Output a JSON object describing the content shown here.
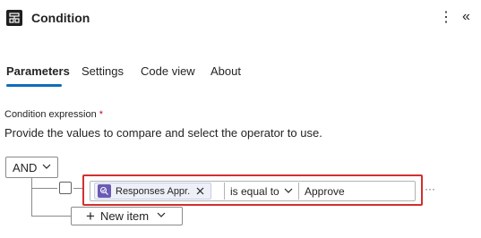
{
  "header": {
    "title": "Condition",
    "app_icon": "condition-icon",
    "more_icon": "⋮",
    "collapse_icon": "«"
  },
  "tabs": [
    {
      "label": "Parameters",
      "active": true
    },
    {
      "label": "Settings",
      "active": false
    },
    {
      "label": "Code view",
      "active": false
    },
    {
      "label": "About",
      "active": false
    }
  ],
  "condition": {
    "label": "Condition expression",
    "required_mark": "*",
    "description": "Provide the values to compare and select the operator to use.",
    "group_operator": "AND",
    "rows": [
      {
        "token_label": "Responses Appr...",
        "token_icon": "approvals-icon",
        "operator": "is equal to",
        "value": "Approve",
        "more": "···"
      }
    ],
    "new_item_label": "New item",
    "new_item_icon": "+"
  },
  "colors": {
    "accent": "#0f6cbd",
    "highlight": "#d32f2f",
    "token_bg": "#eef0f8",
    "token_icon_bg": "#6b5ab5",
    "required": "#c50f1f"
  }
}
